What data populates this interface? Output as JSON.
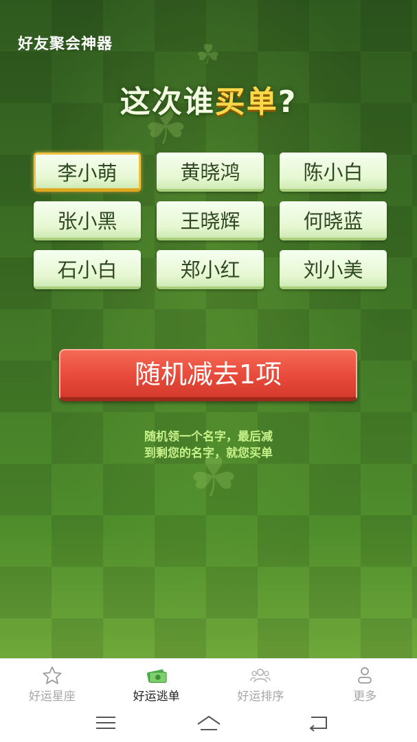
{
  "app": {
    "title": "好友聚会神器"
  },
  "headline": {
    "prefix": "这次谁",
    "accent": "买单",
    "suffix": "?"
  },
  "names": [
    {
      "label": "李小萌",
      "selected": true
    },
    {
      "label": "黄晓鸿",
      "selected": false
    },
    {
      "label": "陈小白",
      "selected": false
    },
    {
      "label": "张小黑",
      "selected": false
    },
    {
      "label": "王晓辉",
      "selected": false
    },
    {
      "label": "何晓蓝",
      "selected": false
    },
    {
      "label": "石小白",
      "selected": false
    },
    {
      "label": "郑小红",
      "selected": false
    },
    {
      "label": "刘小美",
      "selected": false
    }
  ],
  "action": {
    "label": "随机减去1项"
  },
  "hint": {
    "line1": "随机领一个名字，最后减",
    "line2": "到剩您的名字，就您买单"
  },
  "tabs": [
    {
      "label": "好运星座",
      "icon": "star-icon",
      "active": false
    },
    {
      "label": "好运逃单",
      "icon": "money-icon",
      "active": true
    },
    {
      "label": "好运排序",
      "icon": "people-icon",
      "active": false
    },
    {
      "label": "更多",
      "icon": "user-icon",
      "active": false
    }
  ],
  "system_nav": [
    "menu-icon",
    "home-icon",
    "back-icon"
  ],
  "colors": {
    "accent": "#ffd84a",
    "action": "#e84a3a",
    "hint": "#c6f08a",
    "background": "#3f7426"
  }
}
